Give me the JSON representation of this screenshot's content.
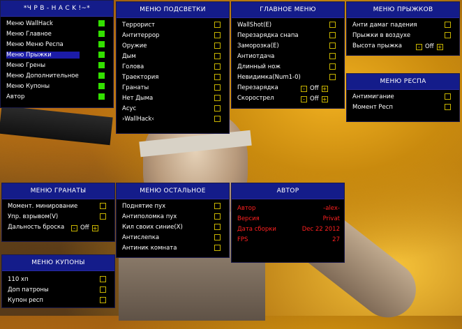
{
  "main_menu": {
    "title": "*Ч Р В - H A C K !~*",
    "items": [
      {
        "label": "Меню WallHack",
        "checked": true
      },
      {
        "label": "Меню Главное",
        "checked": true
      },
      {
        "label": "Меню Меню Респа",
        "checked": true
      },
      {
        "label": "Меню Прыжки",
        "checked": true,
        "selected": true
      },
      {
        "label": "Меню Грены",
        "checked": true
      },
      {
        "label": "Меню Дополнительное",
        "checked": true
      },
      {
        "label": "Меню Купоны",
        "checked": true
      },
      {
        "label": "Автор",
        "checked": true
      }
    ]
  },
  "highlight_menu": {
    "title": "МЕНЮ ПОДСВЕТКИ",
    "items": [
      "Террорист",
      "Антитеррор",
      "Оружие",
      "Дым",
      "Голова",
      "Траектория",
      "Гранаты",
      "Нет Дыма",
      "Асус",
      "›WallHack‹"
    ]
  },
  "general_menu": {
    "title": "ГЛАВНОЕ МЕНЮ",
    "items": [
      "WallShot(E)",
      "Перезарядка снапа",
      "Заморозка(E)",
      "Антиотдача",
      "Длинный нож",
      "Невидимка(Num1-0)"
    ],
    "steppers": [
      {
        "label": "Перезарядка",
        "value": "Off",
        "minus": "-",
        "plus": "+"
      },
      {
        "label": "Скорострел",
        "value": "Off",
        "minus": "-",
        "plus": "+"
      }
    ]
  },
  "jump_menu": {
    "title": "МЕНЮ ПРЫЖКОВ",
    "items": [
      "Анти дамаг падения",
      "Прыжки в воздухе"
    ],
    "stepper": {
      "label": "Высота прыжка",
      "value": "Off",
      "minus": "-",
      "plus": "+"
    }
  },
  "respawn_menu": {
    "title": "МЕНЮ РЕСПА",
    "items": [
      "Антимигание",
      "Момент Респ"
    ]
  },
  "grenade_menu": {
    "title": "МЕНЮ ГРАНАТЫ",
    "items": [
      "Момент. минирование",
      "Упр. взрывом(V)"
    ],
    "stepper": {
      "label": "Дальность броска",
      "value": "Off",
      "minus": "-",
      "plus": "+"
    }
  },
  "other_menu": {
    "title": "МЕНЮ ОСТАЛЬНОЕ",
    "items": [
      "Поднятие пух",
      "Антиполомка пух",
      "Кил своих синие(X)",
      "Антислепка",
      "Антиник комната"
    ]
  },
  "author_menu": {
    "title": "АВТОР",
    "rows": [
      {
        "label": "Автор",
        "value": "-alex-"
      },
      {
        "label": "Версия",
        "value": "Privat"
      },
      {
        "label": "Дата сборки",
        "value": "Dec 22 2012"
      },
      {
        "label": "FPS",
        "value": "27"
      }
    ]
  },
  "coupon_menu": {
    "title": "МЕНЮ КУПОНЫ",
    "items": [
      "110 хп",
      "Доп патроны",
      "Купон респ"
    ]
  },
  "colors": {
    "header_bg": "#141c8a",
    "checkbox_border": "#c8b400",
    "checkbox_on": "#33e000",
    "author_text": "#ff2020"
  }
}
